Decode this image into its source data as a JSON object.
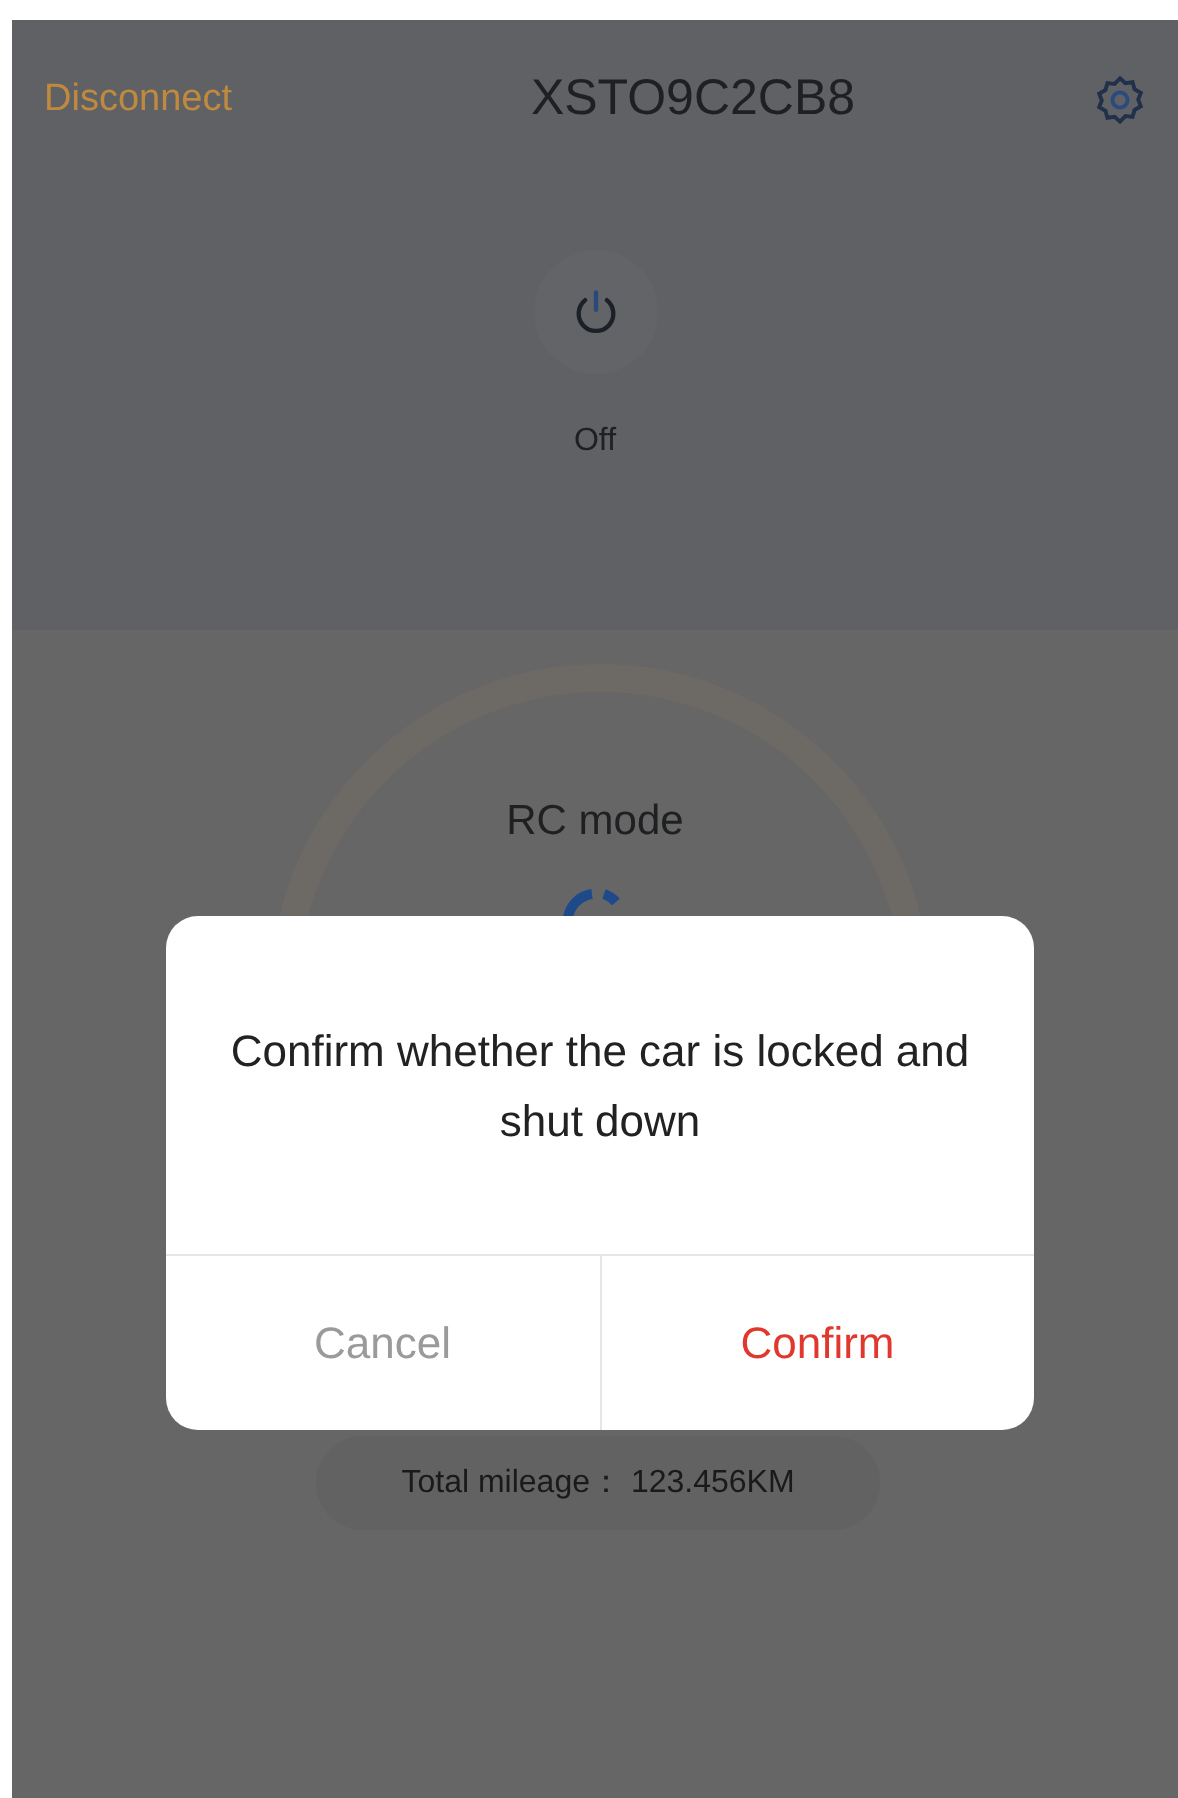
{
  "header": {
    "disconnect": "Disconnect",
    "title": "XSTO9C2CB8"
  },
  "power": {
    "label": "Off"
  },
  "mode": {
    "label": "RC mode"
  },
  "mileage": {
    "label": "Total mileage：",
    "value": "123.456KM"
  },
  "dialog": {
    "message": "Confirm whether the car is locked and shut down",
    "buttons": [
      {
        "label": "Cancel",
        "kind": "cancel"
      },
      {
        "label": "Confirm",
        "kind": "confirm"
      }
    ]
  }
}
